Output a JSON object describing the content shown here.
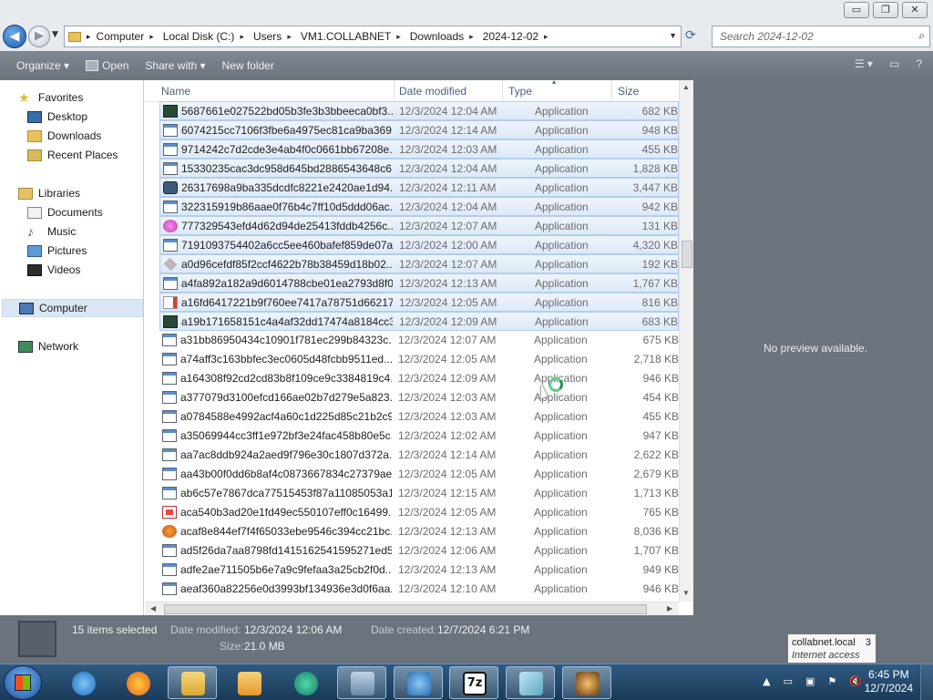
{
  "window": {
    "minimize": "▭",
    "maximize": "❐",
    "close": "✕"
  },
  "address": {
    "crumbs": [
      "Computer",
      "Local Disk (C:)",
      "Users",
      "VM1.COLLABNET",
      "Downloads",
      "2024-12-02"
    ],
    "search_placeholder": "Search 2024-12-02"
  },
  "toolbar": {
    "organize": "Organize ▾",
    "open": "Open",
    "share_with": "Share with ▾",
    "new_folder": "New folder"
  },
  "nav": {
    "favorites": "Favorites",
    "desktop": "Desktop",
    "downloads": "Downloads",
    "recent_places": "Recent Places",
    "libraries": "Libraries",
    "documents": "Documents",
    "music": "Music",
    "pictures": "Pictures",
    "videos": "Videos",
    "computer": "Computer",
    "network": "Network"
  },
  "columns": {
    "name": "Name",
    "date_modified": "Date modified",
    "type": "Type",
    "size": "Size"
  },
  "files": [
    {
      "name": "5687661e027522bd05b3fe3b3bbeeca0bf3...",
      "date": "12/3/2024 12:04 AM",
      "type": "Application",
      "size": "682 KB",
      "icon": "dark",
      "selected": true
    },
    {
      "name": "6074215cc7106f3fbe6a4975ec81ca9ba369...",
      "date": "12/3/2024 12:14 AM",
      "type": "Application",
      "size": "948 KB",
      "icon": "app",
      "selected": true
    },
    {
      "name": "9714242c7d2cde3e4ab4f0c0661bb67208e...",
      "date": "12/3/2024 12:03 AM",
      "type": "Application",
      "size": "455 KB",
      "icon": "app",
      "selected": true
    },
    {
      "name": "15330235cac3dc958d645bd2886543648c6...",
      "date": "12/3/2024 12:04 AM",
      "type": "Application",
      "size": "1,828 KB",
      "icon": "app",
      "selected": true
    },
    {
      "name": "26317698a9ba335dcdfc8221e2420ae1d94...",
      "date": "12/3/2024 12:11 AM",
      "type": "Application",
      "size": "3,447 KB",
      "icon": "gear",
      "selected": true
    },
    {
      "name": "322315919b86aae0f76b4c7ff10d5ddd06ac...",
      "date": "12/3/2024 12:04 AM",
      "type": "Application",
      "size": "942 KB",
      "icon": "app",
      "selected": true
    },
    {
      "name": "777329543efd4d62d94de25413fddb4256c...",
      "date": "12/3/2024 12:07 AM",
      "type": "Application",
      "size": "131 KB",
      "icon": "pink",
      "selected": true
    },
    {
      "name": "7191093754402a6cc5ee460bafef859de07a...",
      "date": "12/3/2024 12:00 AM",
      "type": "Application",
      "size": "4,320 KB",
      "icon": "app",
      "selected": true
    },
    {
      "name": "a0d96cefdf85f2ccf4622b78b38459d18b02...",
      "date": "12/3/2024 12:07 AM",
      "type": "Application",
      "size": "192 KB",
      "icon": "diamond",
      "selected": true
    },
    {
      "name": "a4fa892a182a9d6014788cbe01ea2793d8f0...",
      "date": "12/3/2024 12:13 AM",
      "type": "Application",
      "size": "1,767 KB",
      "icon": "app",
      "selected": true
    },
    {
      "name": "a16fd6417221b9f760ee7417a78751d66217...",
      "date": "12/3/2024 12:05 AM",
      "type": "Application",
      "size": "816 KB",
      "icon": "doc",
      "selected": true
    },
    {
      "name": "a19b171658151c4a4af32dd17474a8184cc3...",
      "date": "12/3/2024 12:09 AM",
      "type": "Application",
      "size": "683 KB",
      "icon": "dark",
      "selected": true
    },
    {
      "name": "a31bb86950434c10901f781ec299b84323c...",
      "date": "12/3/2024 12:07 AM",
      "type": "Application",
      "size": "675 KB",
      "icon": "app",
      "selected": false
    },
    {
      "name": "a74aff3c163bbfec3ec0605d48fcbb9511ed...",
      "date": "12/3/2024 12:05 AM",
      "type": "Application",
      "size": "2,718 KB",
      "icon": "app",
      "selected": false
    },
    {
      "name": "a164308f92cd2cd83b8f109ce9c3384819c4...",
      "date": "12/3/2024 12:09 AM",
      "type": "Application",
      "size": "946 KB",
      "icon": "app",
      "selected": false
    },
    {
      "name": "a377079d3100efcd166ae02b7d279e5a823...",
      "date": "12/3/2024 12:03 AM",
      "type": "Application",
      "size": "454 KB",
      "icon": "app",
      "selected": false
    },
    {
      "name": "a0784588e4992acf4a60c1d225d85c21b2c9...",
      "date": "12/3/2024 12:03 AM",
      "type": "Application",
      "size": "455 KB",
      "icon": "app",
      "selected": false
    },
    {
      "name": "a35069944cc3ff1e972bf3e24fac458b80e5c...",
      "date": "12/3/2024 12:02 AM",
      "type": "Application",
      "size": "947 KB",
      "icon": "app",
      "selected": false
    },
    {
      "name": "aa7ac8ddb924a2aed9f796e30c1807d372a...",
      "date": "12/3/2024 12:14 AM",
      "type": "Application",
      "size": "2,622 KB",
      "icon": "app",
      "selected": false
    },
    {
      "name": "aa43b00f0dd6b8af4c0873667834c27379ae...",
      "date": "12/3/2024 12:05 AM",
      "type": "Application",
      "size": "2,679 KB",
      "icon": "app",
      "selected": false
    },
    {
      "name": "ab6c57e7867dca77515453f87a11085053a1...",
      "date": "12/3/2024 12:15 AM",
      "type": "Application",
      "size": "1,713 KB",
      "icon": "app",
      "selected": false
    },
    {
      "name": "aca540b3ad20e1fd49ec550107eff0c16499...",
      "date": "12/3/2024 12:05 AM",
      "type": "Application",
      "size": "765 KB",
      "icon": "red",
      "selected": false
    },
    {
      "name": "acaf8e844ef7f4f65033ebe9546c394cc21bc...",
      "date": "12/3/2024 12:13 AM",
      "type": "Application",
      "size": "8,036 KB",
      "icon": "orange",
      "selected": false
    },
    {
      "name": "ad5f26da7aa8798fd1415162541595271ed5...",
      "date": "12/3/2024 12:06 AM",
      "type": "Application",
      "size": "1,707 KB",
      "icon": "app",
      "selected": false
    },
    {
      "name": "adfe2ae711505b6e7a9c9fefaa3a25cb2f0d...",
      "date": "12/3/2024 12:13 AM",
      "type": "Application",
      "size": "949 KB",
      "icon": "app",
      "selected": false
    },
    {
      "name": "aeaf360a82256e0d3993bf134936e3d0f6aa...",
      "date": "12/3/2024 12:10 AM",
      "type": "Application",
      "size": "946 KB",
      "icon": "app",
      "selected": false
    }
  ],
  "preview": {
    "text": "No preview available."
  },
  "details": {
    "items_selected": "15 items selected",
    "date_modified_label": "Date modified:",
    "date_modified": "12/3/2024 12:06 AM",
    "date_created_label": "Date created:",
    "date_created": "12/7/2024 6:21 PM",
    "size_label": "Size:",
    "size": "21.0 MB"
  },
  "tooltip": {
    "line1": "collabnet.local",
    "line2": "Internet access",
    "count": "3"
  },
  "clock": {
    "time": "6:45 PM",
    "date": "12/7/2024"
  },
  "taskbar_icons": [
    "internet-explorer-icon",
    "firefox-icon",
    "file-explorer-icon",
    "media-player-icon",
    "chat-app-icon",
    "network-tool-icon",
    "search-tool-icon",
    "7zip-icon",
    "notepad-icon",
    "game-icon"
  ]
}
